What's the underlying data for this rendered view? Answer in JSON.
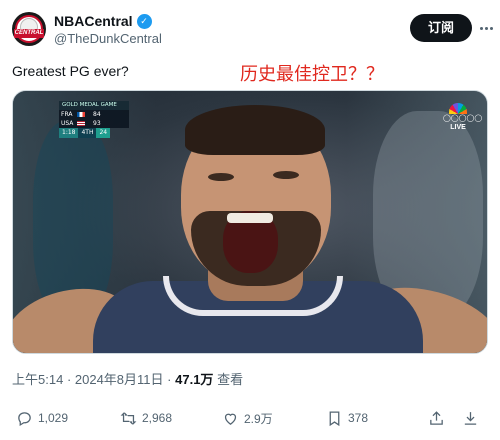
{
  "account": {
    "display_name": "NBACentral",
    "handle": "@TheDunkCentral",
    "avatar_text": "CENTRAL"
  },
  "header": {
    "subscribe_label": "订阅"
  },
  "tweet": {
    "text": "Greatest PG ever?",
    "overlay_caption": "历史最佳控卫？？"
  },
  "media": {
    "scorebug": {
      "title": "GOLD MEDAL GAME",
      "teams": [
        {
          "code": "FRA",
          "score": "84"
        },
        {
          "code": "USA",
          "score": "93"
        }
      ],
      "clock": "1:18",
      "quarter": "4TH",
      "shot_clock": "24"
    },
    "broadcaster": {
      "rings": "◯◯◯◯◯",
      "live_label": "LIVE"
    }
  },
  "meta": {
    "time": "上午5:14",
    "date": "2024年8月11日",
    "views": "47.1万",
    "views_label": "查看"
  },
  "actions": {
    "replies": "1,029",
    "reposts": "2,968",
    "likes": "2.9万",
    "bookmarks": "378"
  },
  "colors": {
    "verified": "#1d9bf0",
    "caption": "#e0281e",
    "subscribe_bg": "#0f1419"
  }
}
